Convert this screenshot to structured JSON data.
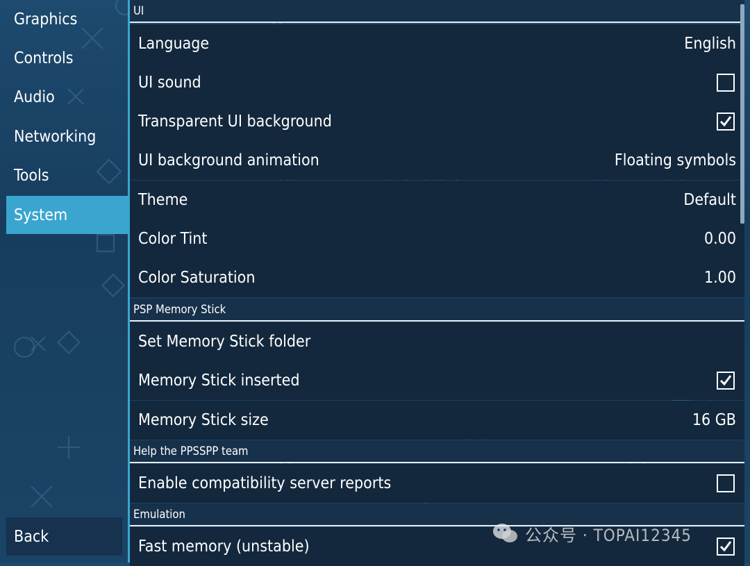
{
  "sidebar": {
    "tabs": [
      {
        "label": "Graphics",
        "active": false
      },
      {
        "label": "Controls",
        "active": false
      },
      {
        "label": "Audio",
        "active": false
      },
      {
        "label": "Networking",
        "active": false
      },
      {
        "label": "Tools",
        "active": false
      },
      {
        "label": "System",
        "active": true
      }
    ],
    "back_label": "Back"
  },
  "sections": {
    "ui": {
      "header": "UI",
      "language": {
        "label": "Language",
        "value": "English"
      },
      "ui_sound": {
        "label": "UI sound",
        "checked": false
      },
      "transparent_bg": {
        "label": "Transparent UI background",
        "checked": true
      },
      "bg_animation": {
        "label": "UI background animation",
        "value": "Floating symbols"
      },
      "theme": {
        "label": "Theme",
        "value": "Default"
      },
      "color_tint": {
        "label": "Color Tint",
        "value": "0.00"
      },
      "color_saturation": {
        "label": "Color Saturation",
        "value": "1.00"
      }
    },
    "memstick": {
      "header": "PSP Memory Stick",
      "set_folder": {
        "label": "Set Memory Stick folder"
      },
      "inserted": {
        "label": "Memory Stick inserted",
        "checked": true
      },
      "size": {
        "label": "Memory Stick size",
        "value": "16 GB"
      }
    },
    "help": {
      "header": "Help the PPSSPP team",
      "compat_reports": {
        "label": "Enable compatibility server reports",
        "checked": false
      }
    },
    "emulation": {
      "header": "Emulation",
      "fast_memory": {
        "label": "Fast memory (unstable)",
        "checked": true
      }
    }
  },
  "watermark": {
    "text": "公众号 · TOPAI12345",
    "icon": "wechat-icon"
  },
  "colors": {
    "accent": "#3aa5cf",
    "row_bg": "#13283d",
    "header_bg": "#17314b"
  }
}
